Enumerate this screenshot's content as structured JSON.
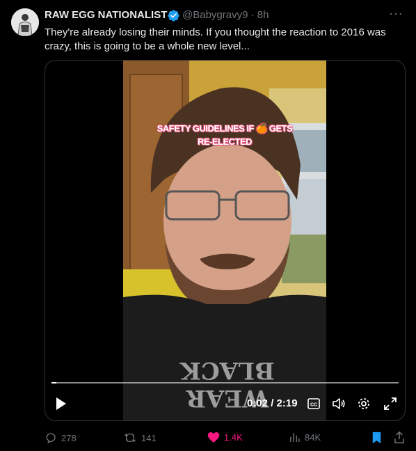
{
  "tweet": {
    "author_name": "RAW EGG NATIONALIST",
    "handle": "@Babygravy9",
    "separator": "·",
    "time": "8h",
    "more_label": "···",
    "text": "They're already losing their minds. If you thought the reaction to 2016 was crazy, this is going to be a whole new level..."
  },
  "video": {
    "caption_line1": "SAFETY GUIDELINES IF 🍊 GETS",
    "caption_line2": "RE-ELECTED",
    "time_display": "0:02 / 2:19",
    "progress": 0.014,
    "shirt_text": "WEAR BLACK"
  },
  "actions": {
    "replies": "278",
    "reposts": "141",
    "likes": "1.4K",
    "views": "84K"
  },
  "colors": {
    "like": "#f91880",
    "bookmark": "#1d9bf0",
    "verified": "#1d9bf0",
    "muted": "#71767b"
  }
}
